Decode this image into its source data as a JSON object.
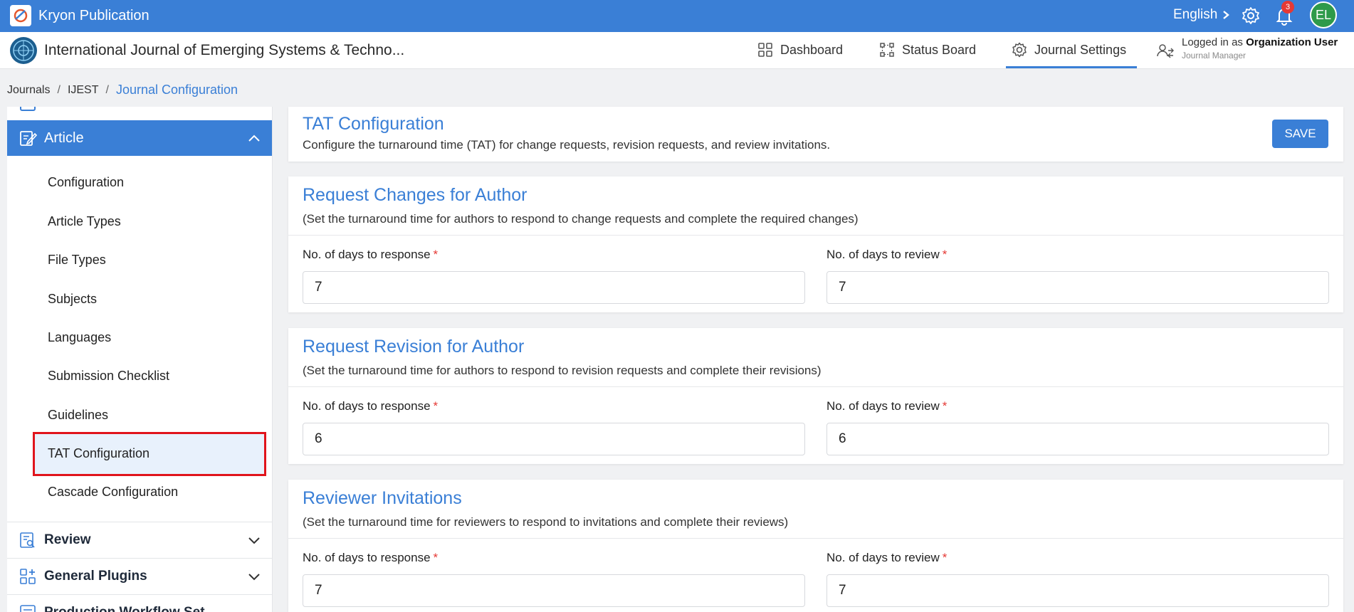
{
  "topbar": {
    "brand": "Kryon Publication",
    "language": "English",
    "notification_count": "3",
    "avatar_initials": "EL",
    "accent_color": "#3a7fd6"
  },
  "header": {
    "journal_title": "International Journal of Emerging Systems & Techno...",
    "nav": [
      {
        "label": "Dashboard",
        "icon": "grid-icon"
      },
      {
        "label": "Status Board",
        "icon": "flow-board-icon"
      },
      {
        "label": "Journal Settings",
        "icon": "gear-icon",
        "active": true
      }
    ],
    "logged_in_prefix": "Logged in as",
    "logged_in_user": "Organization User",
    "logged_in_role": "Journal Manager"
  },
  "breadcrumb": [
    "Journals",
    "IJEST",
    "Journal Configuration"
  ],
  "sidebar": {
    "article_label": "Article",
    "items": [
      "Configuration",
      "Article Types",
      "File Types",
      "Subjects",
      "Languages",
      "Submission Checklist",
      "Guidelines",
      "TAT Configuration",
      "Cascade Configuration"
    ],
    "active_item": "TAT Configuration",
    "sections": [
      "Review",
      "General Plugins",
      "Production Workflow Set..."
    ]
  },
  "main": {
    "title": "TAT Configuration",
    "description": "Configure the turnaround time (TAT) for change requests, revision requests, and review invitations.",
    "save_label": "SAVE",
    "sections": [
      {
        "title": "Request Changes for Author",
        "description": "(Set the turnaround time for authors to respond to change requests and complete the required changes)",
        "response_label": "No. of days to response",
        "review_label": "No. of days to review",
        "response_value": "7",
        "review_value": "7"
      },
      {
        "title": "Request Revision for Author",
        "description": "(Set the turnaround time for authors to respond to revision requests and complete their revisions)",
        "response_label": "No. of days to response",
        "review_label": "No. of days to review",
        "response_value": "6",
        "review_value": "6"
      },
      {
        "title": "Reviewer Invitations",
        "description": "(Set the turnaround time for reviewers to respond to invitations and complete their reviews)",
        "response_label": "No. of days to response",
        "review_label": "No. of days to review",
        "response_value": "7",
        "review_value": "7"
      }
    ]
  }
}
